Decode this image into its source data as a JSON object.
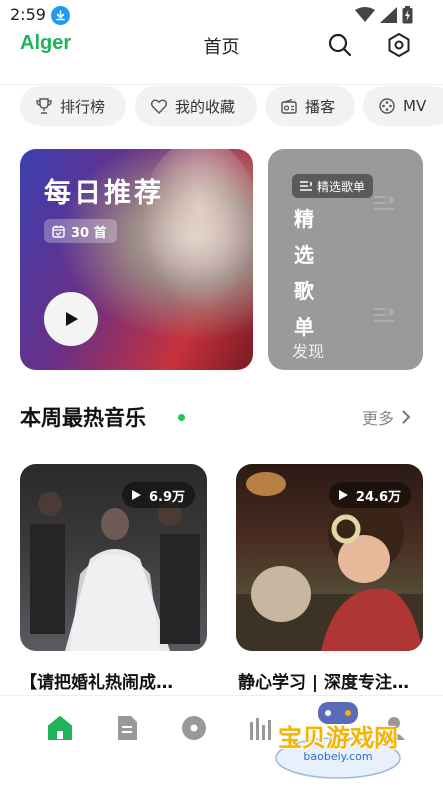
{
  "status_bar": {
    "time": "2:59"
  },
  "header": {
    "logo": "Alger",
    "title": "首页"
  },
  "categories": [
    {
      "label": "排行榜",
      "icon": "trophy-icon"
    },
    {
      "label": "我的收藏",
      "icon": "heart-icon"
    },
    {
      "label": "播客",
      "icon": "radio-icon"
    },
    {
      "label": "MV",
      "icon": "film-reel-icon"
    }
  ],
  "daily": {
    "title": "每日推荐",
    "count": "30 首"
  },
  "featured_playlist": {
    "tag": "精选歌单",
    "vertical_title": [
      "精",
      "选",
      "歌",
      "单"
    ],
    "subtitle": "发现最新"
  },
  "hot": {
    "title": "本周最热音乐",
    "more": "更多",
    "items": [
      {
        "name": "【请把婚礼热闹成…",
        "plays": "6.9万"
      },
      {
        "name": "静心学习 | 深度专注…",
        "plays": "24.6万"
      }
    ]
  },
  "bottom_nav": [
    {
      "name": "home",
      "icon": "home-icon",
      "active": true
    },
    {
      "name": "list",
      "icon": "document-icon",
      "active": false
    },
    {
      "name": "album",
      "icon": "disc-icon",
      "active": false
    },
    {
      "name": "charts",
      "icon": "equalizer-icon",
      "active": false
    },
    {
      "name": "profile",
      "icon": "user-icon",
      "active": false
    }
  ],
  "watermark": {
    "title": "宝贝游戏网",
    "url": "baobeiy.com"
  },
  "colors": {
    "accent": "#20b35a",
    "dot": "#20c45a",
    "chip_bg": "#f2f2f2"
  }
}
